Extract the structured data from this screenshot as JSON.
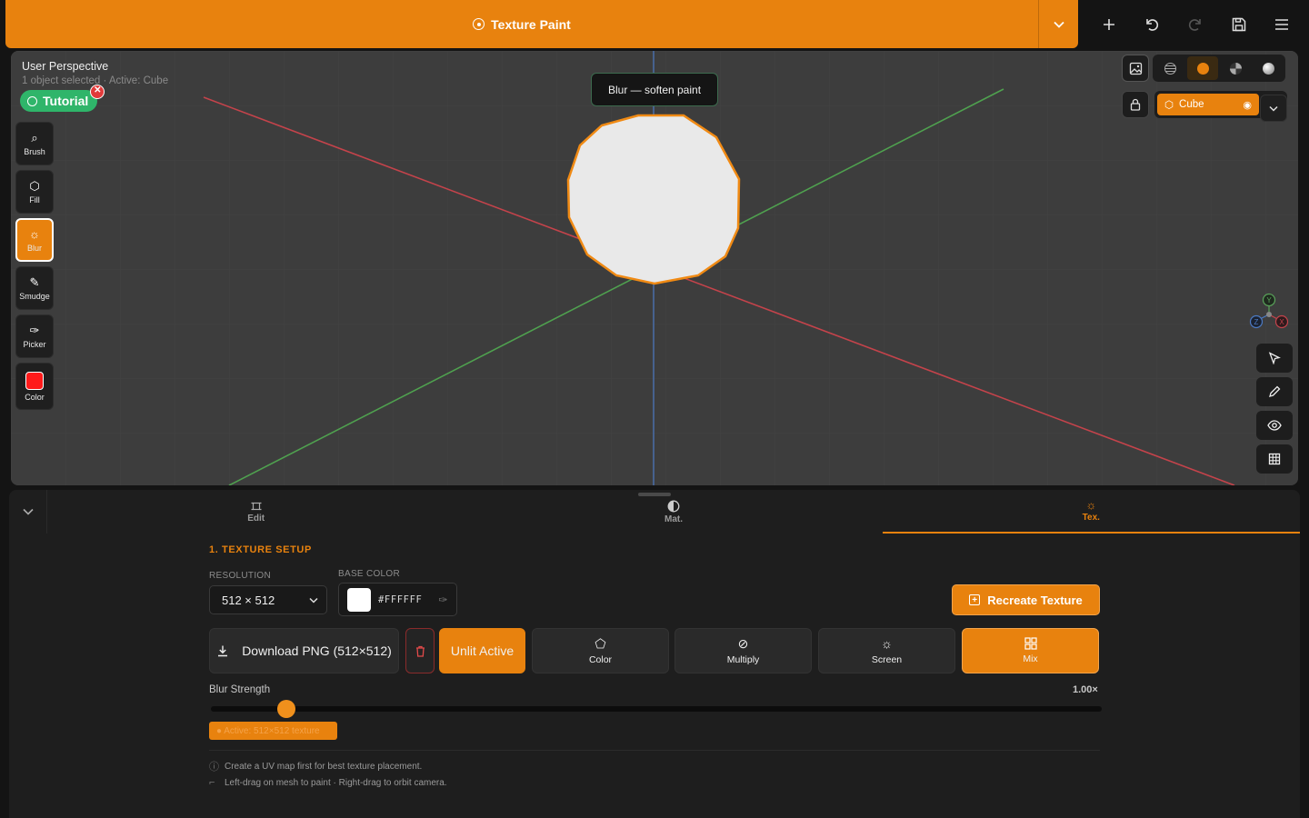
{
  "topbar": {
    "title": "Texture Paint",
    "title_icon": "target-icon",
    "dropdown_icon": "chevron-down-icon",
    "actions": [
      "plus-icon",
      "undo-icon",
      "redo-icon",
      "save-icon",
      "menu-icon"
    ],
    "accent_color": "#e8820e"
  },
  "viewport": {
    "title": "User Perspective",
    "subtitle": "1 object selected · Active: Cube",
    "tutorial_label": "Tutorial",
    "tooltip": "Blur — soften paint",
    "tools": [
      {
        "label": "Brush",
        "icon": "brush-icon",
        "active": false
      },
      {
        "label": "Fill",
        "icon": "fill-icon",
        "active": false
      },
      {
        "label": "Blur",
        "icon": "blur-icon",
        "active": true
      },
      {
        "label": "Smudge",
        "icon": "smudge-icon",
        "active": false
      },
      {
        "label": "Picker",
        "icon": "eyedropper-icon",
        "active": false
      },
      {
        "label": "Color",
        "icon": "color-swatch-icon",
        "active": false
      }
    ],
    "paint_color": "#ff1a1a",
    "shading_modes": [
      "wireframe-icon",
      "solid-icon",
      "material-icon",
      "rendered-icon"
    ],
    "active_shading": "solid",
    "object_name": "Cube",
    "axis_labels": [
      "Y",
      "Z",
      "X"
    ]
  },
  "panel": {
    "tabs": [
      {
        "label": "Edit",
        "icon": "edit-frame-icon",
        "active": false
      },
      {
        "label": "Mat.",
        "icon": "material-half-icon",
        "active": false
      },
      {
        "label": "Tex.",
        "icon": "texture-sun-icon",
        "active": true
      }
    ],
    "section_title": "1. TEXTURE SETUP",
    "resolution_label": "RESOLUTION",
    "resolution_value": "512 × 512",
    "base_color_label": "BASE COLOR",
    "base_color_value": "#FFFFFF",
    "recreate_label": "Recreate Texture",
    "download_label": "Download PNG (512×512)",
    "unlit_label": "Unlit Active",
    "blend_modes": [
      {
        "label": "Color",
        "icon": "tag-icon",
        "active": false
      },
      {
        "label": "Multiply",
        "icon": "multiply-icon",
        "active": false
      },
      {
        "label": "Screen",
        "icon": "screen-sun-icon",
        "active": false
      },
      {
        "label": "Mix",
        "icon": "grid-icon",
        "active": true
      }
    ],
    "blur_strength_label": "Blur Strength",
    "blur_strength_value": "1.00×",
    "blur_strength_fraction": 0.085,
    "active_badge": "● Active: 512×512 texture",
    "hint1": "Create a UV map first for best texture placement.",
    "hint2": "Left-drag on mesh to paint · Right-drag to orbit camera."
  }
}
